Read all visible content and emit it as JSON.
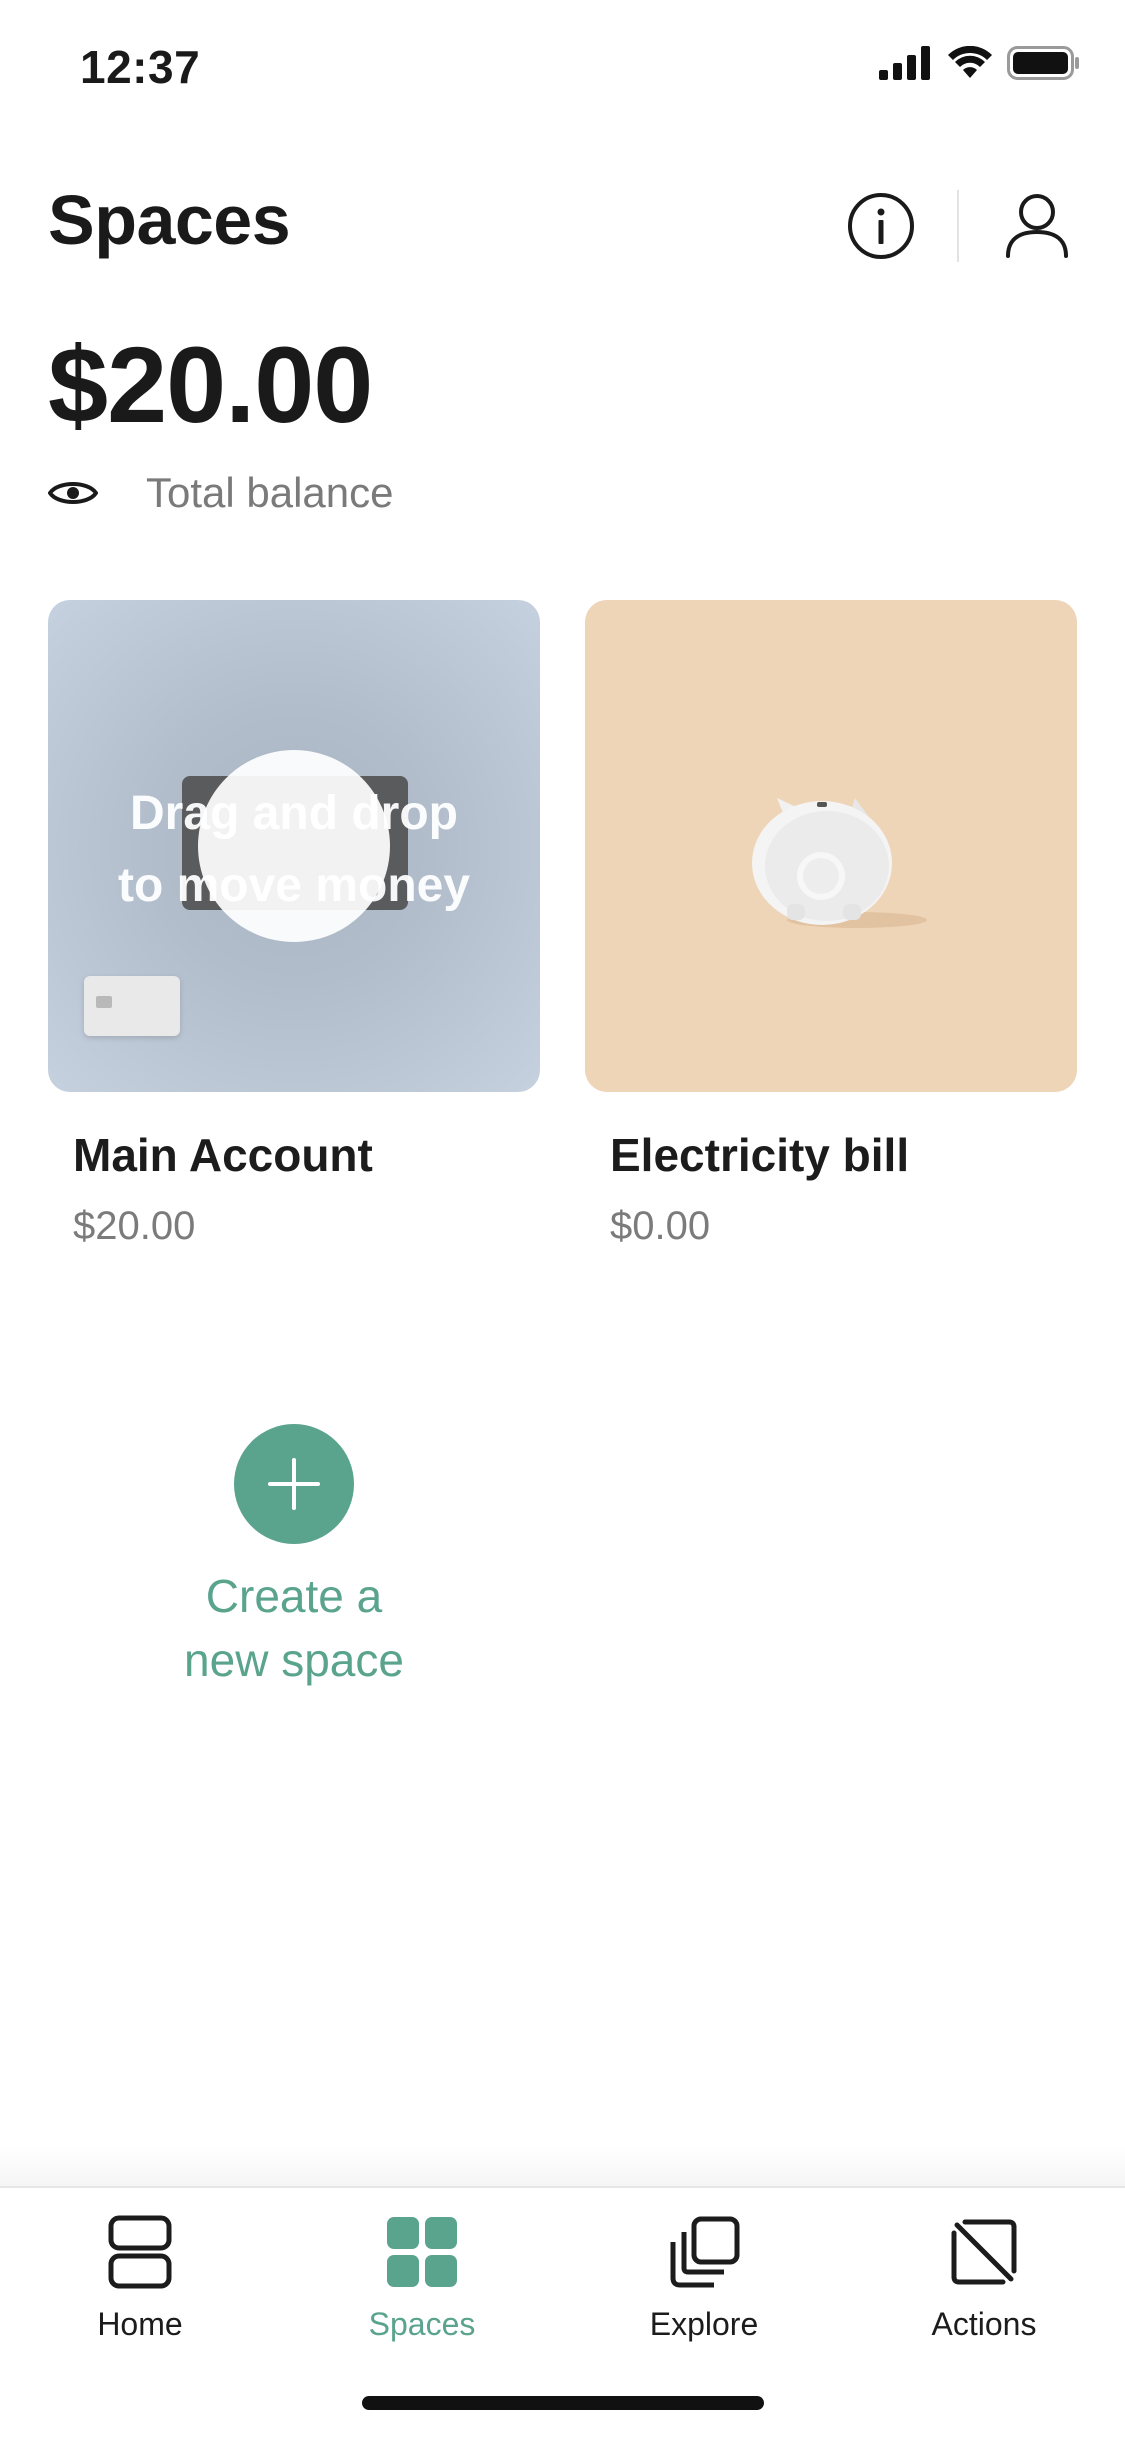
{
  "status_bar": {
    "time": "12:37",
    "icons": [
      "cellular-signal-icon",
      "wifi-icon",
      "battery-icon"
    ]
  },
  "header": {
    "title": "Spaces",
    "info_icon": "info-icon",
    "profile_icon": "user-profile-icon"
  },
  "balance": {
    "amount": "$20.00",
    "label": "Total balance",
    "visibility_icon": "eye-icon"
  },
  "spaces": [
    {
      "name": "Main Account",
      "balance": "$20.00",
      "overlay_hint": "Drag and drop\nto move money"
    },
    {
      "name": "Electricity bill",
      "balance": "$0.00"
    }
  ],
  "create_space": {
    "label": "Create a\nnew space",
    "icon": "plus-icon"
  },
  "tabs": [
    {
      "label": "Home",
      "icon": "home-icon",
      "active": false
    },
    {
      "label": "Spaces",
      "icon": "spaces-grid-icon",
      "active": true
    },
    {
      "label": "Explore",
      "icon": "explore-icon",
      "active": false
    },
    {
      "label": "Actions",
      "icon": "actions-icon",
      "active": false
    }
  ],
  "colors": {
    "accent": "#5aa38d",
    "text_primary": "#1a1a1a",
    "text_secondary": "#7a7a7a",
    "main_card_bg": "#b8c3d1",
    "electricity_card_bg": "#efd5b8"
  }
}
